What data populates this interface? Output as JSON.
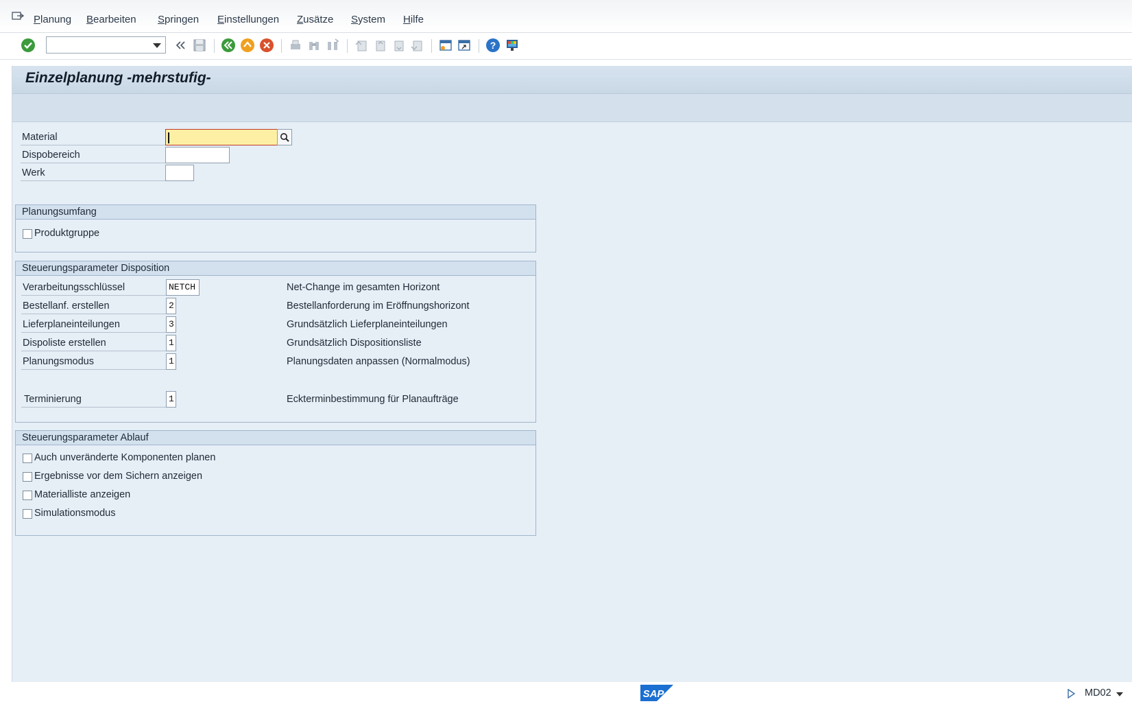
{
  "menubar": {
    "items": [
      "Planung",
      "Bearbeiten",
      "Springen",
      "Einstellungen",
      "Zusätze",
      "System",
      "Hilfe"
    ],
    "mnemonic_first": [
      "P",
      "B",
      "S",
      "E",
      "Z",
      "S",
      "H"
    ],
    "mnemonic_rest": [
      "lanung",
      "earbeiten",
      "pringen",
      "instellungen",
      "usätze",
      "ystem",
      "ilfe"
    ]
  },
  "toolbar": {
    "command_field_value": "",
    "colors": {
      "ok": "#3c9a3c",
      "back": "#3c9a3c",
      "exit": "#f0a020",
      "cancel": "#d9512c",
      "help": "#2a73c7"
    }
  },
  "page": {
    "title": "Einzelplanung -mehrstufig-"
  },
  "header_fields": [
    {
      "label": "Material",
      "value": ""
    },
    {
      "label": "Dispobereich",
      "value": ""
    },
    {
      "label": "Werk",
      "value": ""
    }
  ],
  "groups": {
    "planungsumfang": {
      "title": "Planungsumfang",
      "checkboxes": [
        {
          "label": "Produktgruppe",
          "checked": false
        }
      ]
    },
    "steuerung_dispo": {
      "title": "Steuerungsparameter Disposition",
      "rows": [
        {
          "label": "Verarbeitungsschlüssel",
          "value": "NETCH",
          "desc": "Net-Change im gesamten Horizont"
        },
        {
          "label": "Bestellanf. erstellen",
          "value": "2",
          "desc": "Bestellanforderung im Eröffnungshorizont"
        },
        {
          "label": "Lieferplaneinteilungen",
          "value": "3",
          "desc": "Grundsätzlich Lieferplaneinteilungen"
        },
        {
          "label": "Dispoliste erstellen",
          "value": "1",
          "desc": "Grundsätzlich Dispositionsliste"
        },
        {
          "label": "Planungsmodus",
          "value": "1",
          "desc": "Planungsdaten anpassen (Normalmodus)"
        },
        {
          "label": "Terminierung",
          "value": "1",
          "desc": "Eckterminbestimmung für Planaufträge"
        }
      ]
    },
    "steuerung_ablauf": {
      "title": "Steuerungsparameter Ablauf",
      "checkboxes": [
        {
          "label": "Auch unveränderte  Komponenten planen",
          "checked": false
        },
        {
          "label": "Ergebnisse vor dem Sichern anzeigen",
          "checked": false
        },
        {
          "label": "Materialliste anzeigen",
          "checked": false
        },
        {
          "label": "Simulationsmodus",
          "checked": false
        }
      ]
    }
  },
  "statusbar": {
    "logo_text": "SAP",
    "transaction": "MD02"
  }
}
